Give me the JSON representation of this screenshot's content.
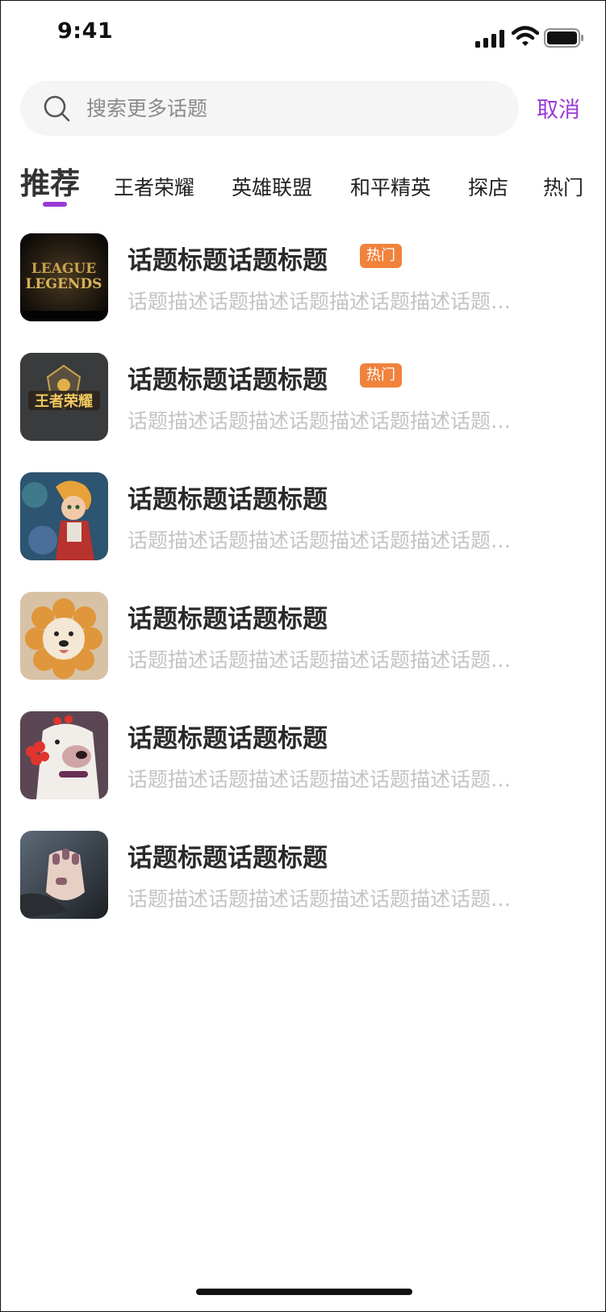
{
  "status_bar": {
    "time": "9:41"
  },
  "search": {
    "placeholder": "搜索更多话题",
    "value": "",
    "cancel_label": "取消"
  },
  "tabs": [
    {
      "label": "推荐",
      "active": true
    },
    {
      "label": "王者荣耀"
    },
    {
      "label": "英雄联盟"
    },
    {
      "label": "和平精英"
    },
    {
      "label": "探店"
    },
    {
      "label": "热门"
    }
  ],
  "topics": [
    {
      "title": "话题标题话题标题",
      "badge": "热门",
      "desc": "话题描述话题描述话题描述话题描述话题描述",
      "thumb_text": "LEAGUE LEGENDS",
      "thumb_icon": "league-of-legends-logo"
    },
    {
      "title": "话题标题话题标题",
      "badge": "热门",
      "desc": "话题描述话题描述话题描述话题描述话题描述",
      "thumb_text": "王者荣耀",
      "thumb_icon": "honor-of-kings-logo"
    },
    {
      "title": "话题标题话题标题",
      "desc": "话题描述话题描述话题描述话题描述话题描述",
      "thumb_icon": "game-character-image"
    },
    {
      "title": "话题标题话题标题",
      "desc": "话题描述话题描述话题描述话题描述话题描述",
      "thumb_icon": "flower-dog-image"
    },
    {
      "title": "话题标题话题标题",
      "desc": "话题描述话题描述话题描述话题描述话题描述",
      "thumb_icon": "dog-with-flower-image"
    },
    {
      "title": "话题标题话题标题",
      "desc": "话题描述话题描述话题描述话题描述话题描述",
      "thumb_icon": "manicure-hand-image"
    }
  ],
  "colors": {
    "accent": "#9a3ad6",
    "badge": "#f0823c",
    "desc_text": "#c3c3c3",
    "search_bg": "#f5f5f5"
  }
}
